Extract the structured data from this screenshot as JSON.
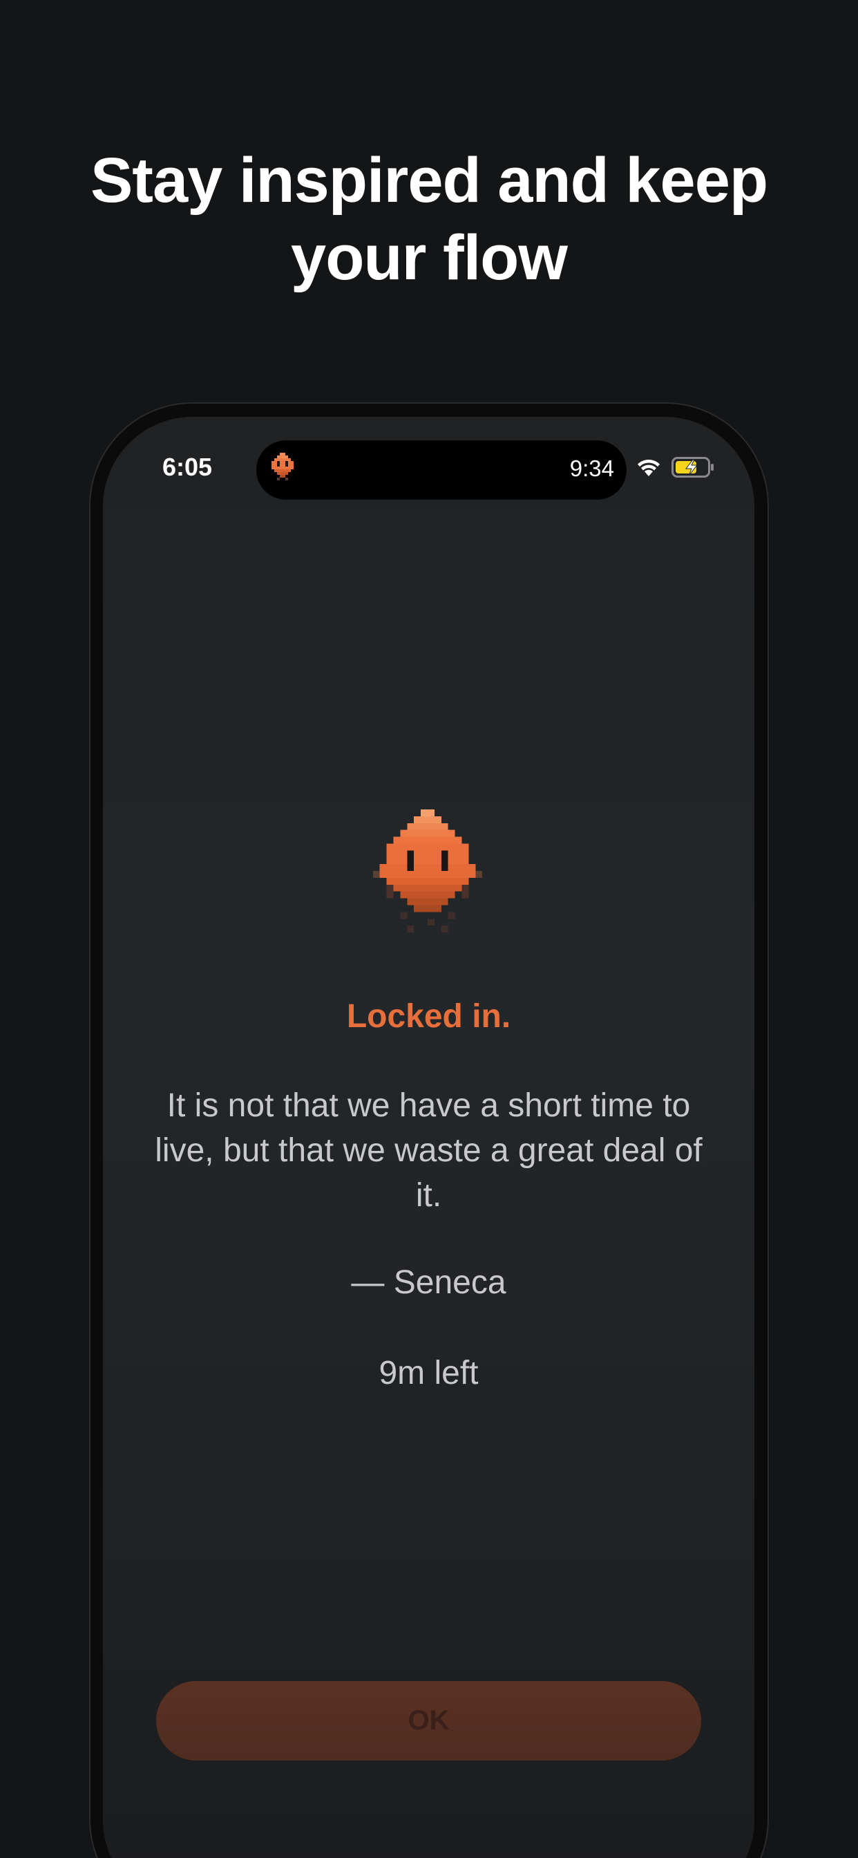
{
  "headline": {
    "line1": "Stay inspired and keep",
    "line2": "your flow"
  },
  "status_bar": {
    "time": "6:05",
    "island_timer": "9:34",
    "island_icon": "mascot-icon",
    "wifi_icon": "wifi-icon",
    "battery_icon": "battery-charging-icon"
  },
  "lock_screen": {
    "mascot_icon": "pixel-mascot-icon",
    "title": "Locked in.",
    "quote": "It is not that we have a short time to live, but that we waste a great deal of it.",
    "author": "— Seneca",
    "time_left": "9m left",
    "ok_label": "OK"
  },
  "colors": {
    "background": "#141516",
    "accent": "#e66f3b",
    "button": "#5a3224",
    "text_muted": "#c9c9cb",
    "battery_charging": "#f7d51d"
  }
}
